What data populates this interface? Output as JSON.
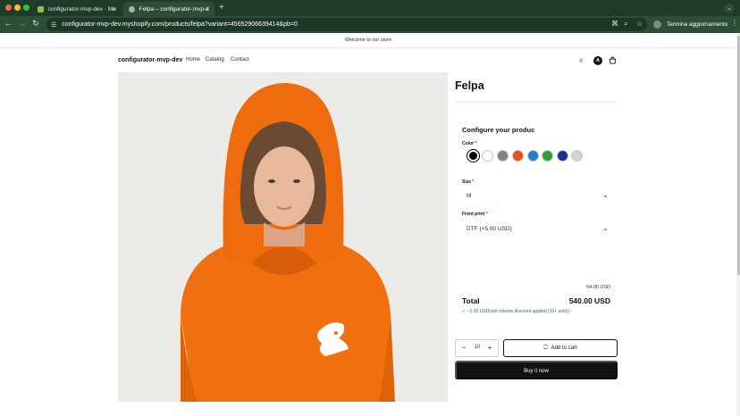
{
  "browser": {
    "tabs": [
      {
        "title": "configurator-mvp-dev · Modi",
        "active": false
      },
      {
        "title": "Felpa – configurator-mvp-de",
        "active": true
      }
    ],
    "url": "configurator-mvp-dev.myshopify.com/products/felpa?variant=45652906639414&pb=0",
    "profile_label": "Termina aggiornamento"
  },
  "store": {
    "announcement": "Welcome to our store",
    "logo": "configurator-mvp-dev",
    "nav": [
      "Home",
      "Catalog",
      "Contact"
    ],
    "account_initial": "A"
  },
  "product": {
    "title": "Felpa",
    "configure_heading": "Configure your produc",
    "color_label": "Color",
    "colors": [
      "#000000",
      "#ffffff",
      "#7d857d",
      "#e0531a",
      "#1a7fd9",
      "#2e9e3e",
      "#1e2f8f",
      "#d7d4d0"
    ],
    "selected_color_index": 0,
    "size_label": "Size",
    "size_value": "M",
    "front_print_label": "Front print",
    "front_print_value": "DTF (+5.00 USD)",
    "required_mark": "*",
    "unit_price": "54.00 USD",
    "total_label": "Total",
    "total_value": "540.00 USD",
    "discount_note": "✓ −1.00 USD/unit volume discount applied (10+ units) ·",
    "quantity": "10",
    "add_to_cart": "Add to cart",
    "buy_now": "Buy it now"
  },
  "colors": {
    "hoodie": "#f0700f",
    "chrome_tab": "#1f3b2a",
    "chrome_bar": "#2c4e37"
  }
}
